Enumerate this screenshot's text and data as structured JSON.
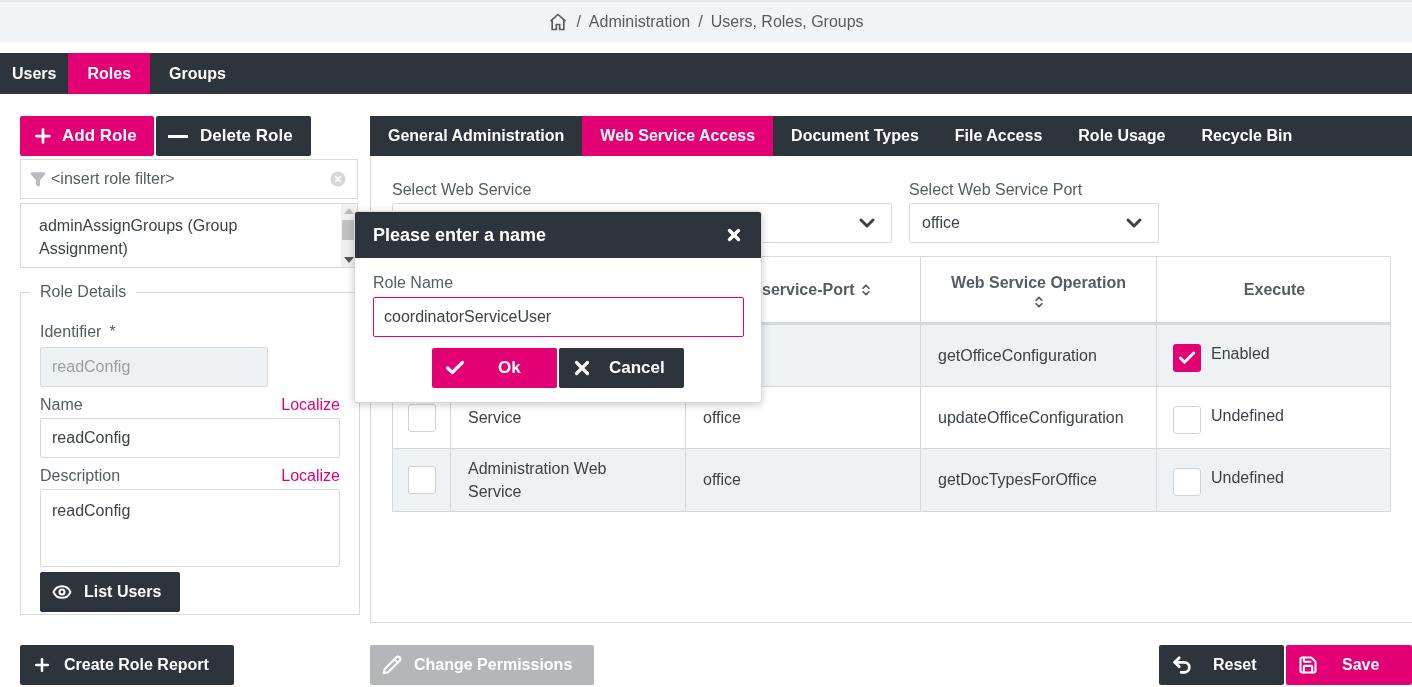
{
  "breadcrumb": {
    "separator": "/",
    "items": [
      "Administration",
      "Users, Roles, Groups"
    ]
  },
  "nav_tabs": [
    {
      "label": "Users",
      "selected": false
    },
    {
      "label": "Roles",
      "selected": true
    },
    {
      "label": "Groups",
      "selected": false
    }
  ],
  "role_actions": {
    "add": "Add Role",
    "delete": "Delete Role"
  },
  "role_filter": {
    "placeholder": "<insert role filter>"
  },
  "role_list": [
    {
      "label": "adminAssignGroups (Group Assignment)"
    }
  ],
  "role_details": {
    "legend": "Role Details",
    "identifier_label": "Identifier",
    "required_mark": "*",
    "identifier": "readConfig",
    "name_label": "Name",
    "name": "readConfig",
    "description_label": "Description",
    "description": "readConfig",
    "name_localize": "Localize",
    "description_localize": "Localize",
    "list_users": "List Users"
  },
  "content_tabs": [
    {
      "label": "General Administration",
      "selected": false
    },
    {
      "label": "Web Service Access",
      "selected": true
    },
    {
      "label": "Document Types",
      "selected": false
    },
    {
      "label": "File Access",
      "selected": false
    },
    {
      "label": "Role Usage",
      "selected": false
    },
    {
      "label": "Recycle Bin",
      "selected": false
    }
  ],
  "web_service_select": {
    "label": "Select Web Service"
  },
  "port_select": {
    "label": "Select Web Service Port",
    "value": "office"
  },
  "table": {
    "columns": [
      "service-Port",
      "Web Service Operation",
      "Execute"
    ],
    "rows": [
      {
        "operation": "getOfficeConfiguration",
        "execute": {
          "checked": true,
          "label": "Enabled"
        }
      },
      {
        "checked": false,
        "service": "Service",
        "port": "office",
        "operation": "updateOfficeConfiguration",
        "execute": {
          "checked": false,
          "label": "Undefined"
        }
      },
      {
        "checked": false,
        "service": "Administration Web Service",
        "port": "office",
        "operation": "getDocTypesForOffice",
        "execute": {
          "checked": false,
          "label": "Undefined"
        }
      }
    ]
  },
  "dialog": {
    "title": "Please enter a name",
    "field_label": "Role Name",
    "value": "coordinatorServiceUser",
    "ok": "Ok",
    "cancel": "Cancel"
  },
  "footer": {
    "create_report": "Create Role Report",
    "change_permissions": {
      "label": "Change Permissions",
      "disabled": true
    },
    "reset": "Reset",
    "save": "Save"
  }
}
